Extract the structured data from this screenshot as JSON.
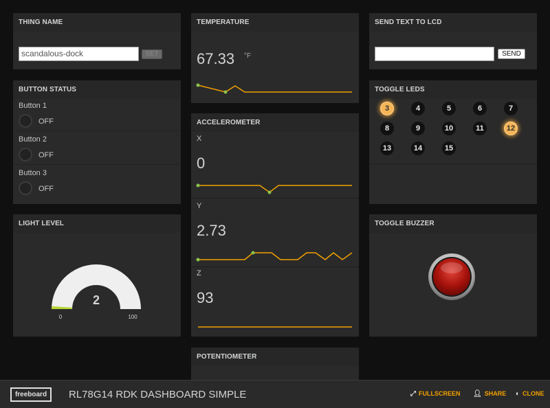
{
  "panels": {
    "thing_name": {
      "title": "THING NAME",
      "input_value": "scandalous-dock",
      "set_label": "SET"
    },
    "button_status": {
      "title": "BUTTON STATUS",
      "buttons": [
        {
          "label": "Button 1",
          "state": "OFF"
        },
        {
          "label": "Button 2",
          "state": "OFF"
        },
        {
          "label": "Button 3",
          "state": "OFF"
        }
      ]
    },
    "light_level": {
      "title": "LIGHT LEVEL",
      "value": "2",
      "min": "0",
      "max": "100",
      "level": 0.02
    },
    "temperature": {
      "title": "TEMPERATURE",
      "value": "67.33",
      "units": "°F"
    },
    "accelerometer": {
      "title": "ACCELEROMETER",
      "x_label": "X",
      "x_value": "0",
      "y_label": "Y",
      "y_value": "2.73",
      "z_label": "Z",
      "z_value": "93"
    },
    "potentiometer": {
      "title": "POTENTIOMETER"
    },
    "send_text": {
      "title": "SEND TEXT TO LCD",
      "input_value": "",
      "send_label": "SEND"
    },
    "toggle_leds": {
      "title": "TOGGLE LEDS",
      "leds": [
        {
          "label": "3",
          "on": true
        },
        {
          "label": "4",
          "on": false
        },
        {
          "label": "5",
          "on": false
        },
        {
          "label": "6",
          "on": false
        },
        {
          "label": "7",
          "on": false
        },
        {
          "label": "8",
          "on": false
        },
        {
          "label": "9",
          "on": false
        },
        {
          "label": "10",
          "on": false
        },
        {
          "label": "11",
          "on": false
        },
        {
          "label": "12",
          "on": true
        },
        {
          "label": "13",
          "on": false
        },
        {
          "label": "14",
          "on": false
        },
        {
          "label": "15",
          "on": false
        }
      ]
    },
    "toggle_buzzer": {
      "title": "TOGGLE BUZZER"
    }
  },
  "header": {
    "logo": "freeboard",
    "board_title": "RL78G14 RDK DASHBOARD SIMPLE",
    "fullscreen_label": "FULLSCREEN",
    "share_label": "SHARE",
    "clone_label": "CLONE"
  },
  "colors": {
    "sparkline": "#f2a100",
    "sparkline_point": "#8bc34a",
    "gauge_fill": "#b6d534",
    "gauge_track": "#efefef",
    "led_on": "#f5b557",
    "buzzer": "#b01a10",
    "accent": "#f2a100"
  },
  "icons": {
    "fullscreen": "expand-arrows-icon",
    "share": "user-icon",
    "clone": "half-circle-icon"
  }
}
